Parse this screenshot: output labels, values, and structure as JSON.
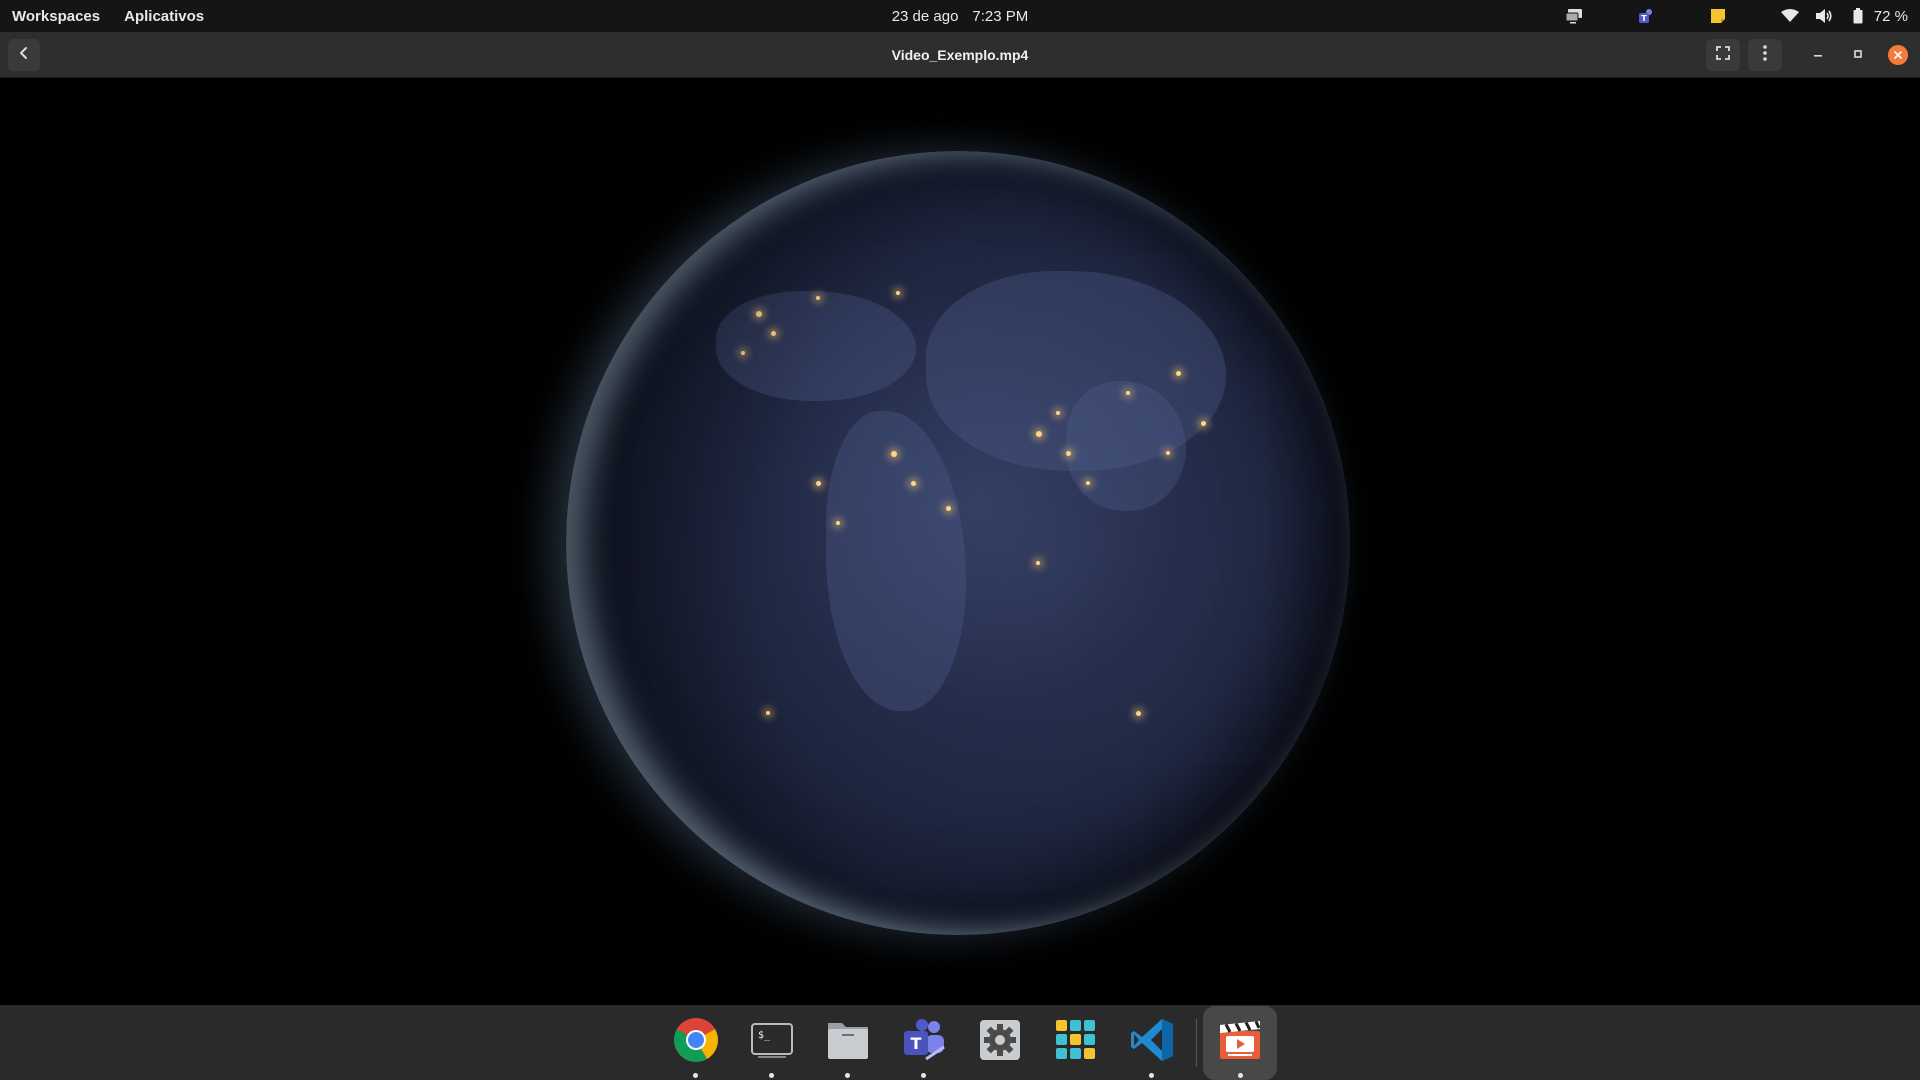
{
  "top_panel": {
    "workspaces_label": "Workspaces",
    "applications_label": "Aplicativos",
    "date": "23 de ago",
    "time": "7:23 PM",
    "battery_percent": "72 %",
    "tray_icons": [
      "screen-share-icon",
      "teams-tray-icon",
      "notes-tray-icon",
      "wifi-icon",
      "volume-icon",
      "battery-icon"
    ]
  },
  "header": {
    "title": "Video_Exemplo.mp4",
    "buttons": [
      "back-icon",
      "fullscreen-icon",
      "menu-icon",
      "minimize-icon",
      "maximize-icon",
      "close-icon"
    ]
  },
  "dock": {
    "items": [
      {
        "name": "chrome",
        "running": true
      },
      {
        "name": "terminal",
        "running": true
      },
      {
        "name": "files",
        "running": true
      },
      {
        "name": "teams",
        "running": true
      },
      {
        "name": "settings",
        "running": false
      },
      {
        "name": "app-grid",
        "running": false
      },
      {
        "name": "vscode",
        "running": true
      },
      {
        "name": "video-player",
        "running": true,
        "active": true
      }
    ]
  },
  "colors": {
    "panel_bg": "#151515",
    "header_bg": "#2e2e2e",
    "dock_bg": "#2a2a2a",
    "close_button": "#f57c3a"
  }
}
